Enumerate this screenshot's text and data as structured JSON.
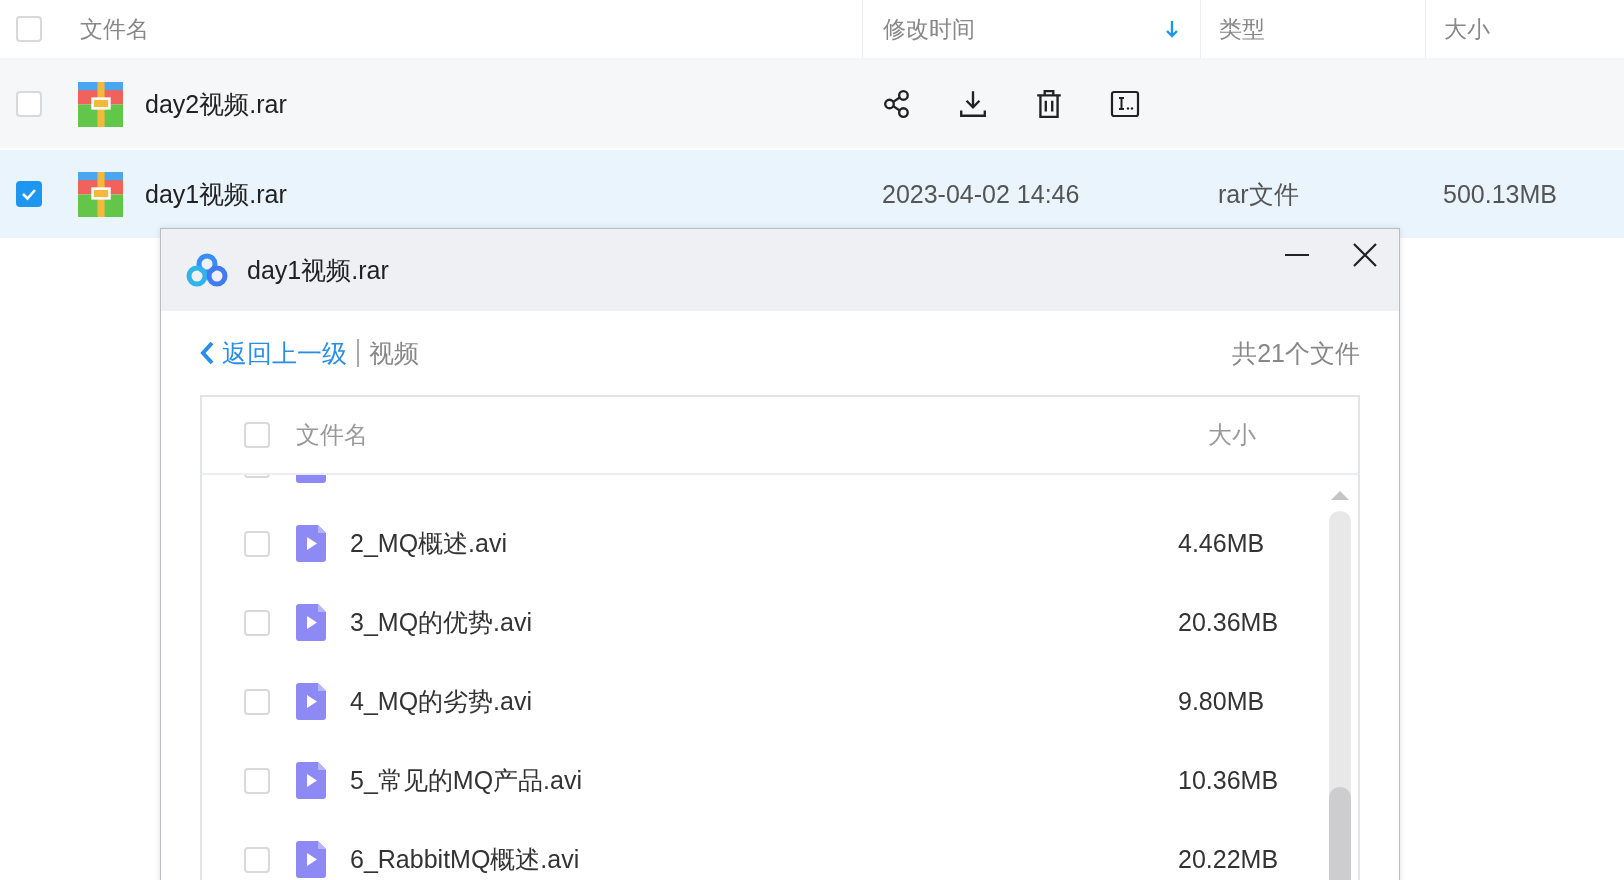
{
  "file_table": {
    "select_all": {
      "checked": false
    },
    "columns": [
      {
        "label": "文件名"
      },
      {
        "label": "修改时间",
        "sorted_descending": true
      },
      {
        "label": "类型"
      },
      {
        "label": "大小"
      }
    ],
    "rows": [
      {
        "name": "day2视频.rar",
        "checked": false,
        "selected": false,
        "hovered": true
      },
      {
        "name": "day1视频.rar",
        "checked": true,
        "selected": true,
        "hovered": false,
        "modified": "2023-04-02 14:46",
        "type": "rar文件",
        "size": "500.13MB"
      }
    ]
  },
  "preview_dialog": {
    "title": "day1视频.rar",
    "back_link": "返回上一级",
    "path": "视频",
    "file_count": "共21个文件",
    "select_all": {
      "checked": false
    },
    "columns": [
      {
        "label": "文件名"
      },
      {
        "label": "大小"
      }
    ],
    "rows": [
      {
        "checked": false
      },
      {
        "name": "2_MQ概述.avi",
        "size": "4.46MB",
        "checked": false
      },
      {
        "name": "3_MQ的优势.avi",
        "size": "20.36MB",
        "checked": false
      },
      {
        "name": "4_MQ的劣势.avi",
        "size": "9.80MB",
        "checked": false
      },
      {
        "name": "5_常见的MQ产品.avi",
        "size": "10.36MB",
        "checked": false
      },
      {
        "name": "6_RabbitMQ概述.avi",
        "size": "20.22MB",
        "checked": false
      }
    ]
  }
}
